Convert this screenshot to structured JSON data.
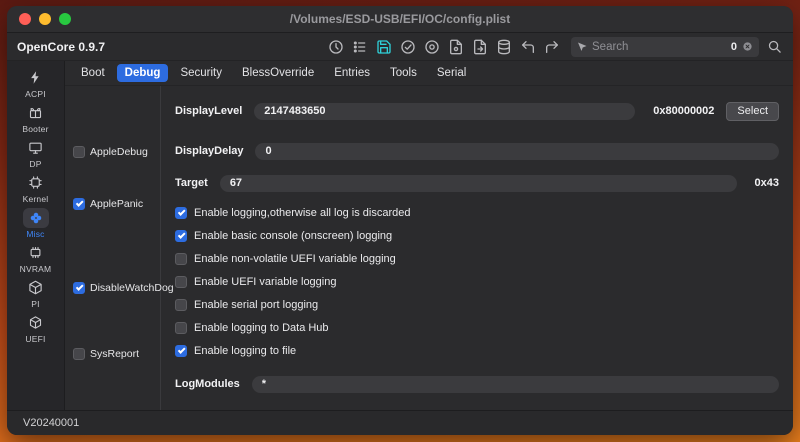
{
  "window": {
    "title": "/Volumes/ESD-USB/EFI/OC/config.plist",
    "app_version": "OpenCore 0.9.7",
    "status_version": "V20240001"
  },
  "toolbar": {
    "icons": [
      "history-icon",
      "list-grid-icon",
      "save-icon",
      "check-circle-icon",
      "target-circle-icon",
      "file-gear-icon",
      "file-export-icon",
      "database-icon",
      "undo-icon",
      "redo-icon",
      "search-cursor-icon",
      "clear-icon",
      "magnifier-icon"
    ],
    "search": {
      "placeholder": "Search",
      "count": "0"
    }
  },
  "sidebar": {
    "items": [
      {
        "label": "ACPI",
        "icon": "acpi-icon"
      },
      {
        "label": "Booter",
        "icon": "booter-icon"
      },
      {
        "label": "DP",
        "icon": "dp-icon"
      },
      {
        "label": "Kernel",
        "icon": "kernel-icon"
      },
      {
        "label": "Misc",
        "icon": "misc-icon",
        "selected": true
      },
      {
        "label": "NVRAM",
        "icon": "nvram-icon"
      },
      {
        "label": "PI",
        "icon": "pi-icon"
      },
      {
        "label": "UEFI",
        "icon": "uefi-icon"
      }
    ]
  },
  "tabs": [
    {
      "label": "Boot"
    },
    {
      "label": "Debug",
      "selected": true
    },
    {
      "label": "Security"
    },
    {
      "label": "BlessOverride"
    },
    {
      "label": "Entries"
    },
    {
      "label": "Tools"
    },
    {
      "label": "Serial"
    }
  ],
  "left_checks": [
    {
      "label": "AppleDebug",
      "checked": false
    },
    {
      "label": "ApplePanic",
      "checked": true
    },
    {
      "label": "DisableWatchDog",
      "checked": true
    },
    {
      "label": "SysReport",
      "checked": false
    }
  ],
  "fields": {
    "display_level": {
      "label": "DisplayLevel",
      "value": "2147483650",
      "hex": "0x80000002",
      "select_label": "Select"
    },
    "display_delay": {
      "label": "DisplayDelay",
      "value": "0"
    },
    "target": {
      "label": "Target",
      "value": "67",
      "hex": "0x43"
    },
    "log_modules": {
      "label": "LogModules",
      "value": "*"
    }
  },
  "options": [
    {
      "label": "Enable logging,otherwise all log is discarded",
      "checked": true
    },
    {
      "label": "Enable basic console (onscreen) logging",
      "checked": true
    },
    {
      "label": "Enable non-volatile UEFI variable logging",
      "checked": false
    },
    {
      "label": "Enable UEFI variable logging",
      "checked": false
    },
    {
      "label": "Enable serial port logging",
      "checked": false
    },
    {
      "label": "Enable logging to Data Hub",
      "checked": false
    },
    {
      "label": "Enable logging to file",
      "checked": true
    }
  ],
  "colors": {
    "accent_blue": "#2d6ce0",
    "save_teal": "#2fd0d8",
    "traffic_red": "#ff5f57",
    "traffic_yellow": "#febc2e",
    "traffic_green": "#28c840"
  }
}
